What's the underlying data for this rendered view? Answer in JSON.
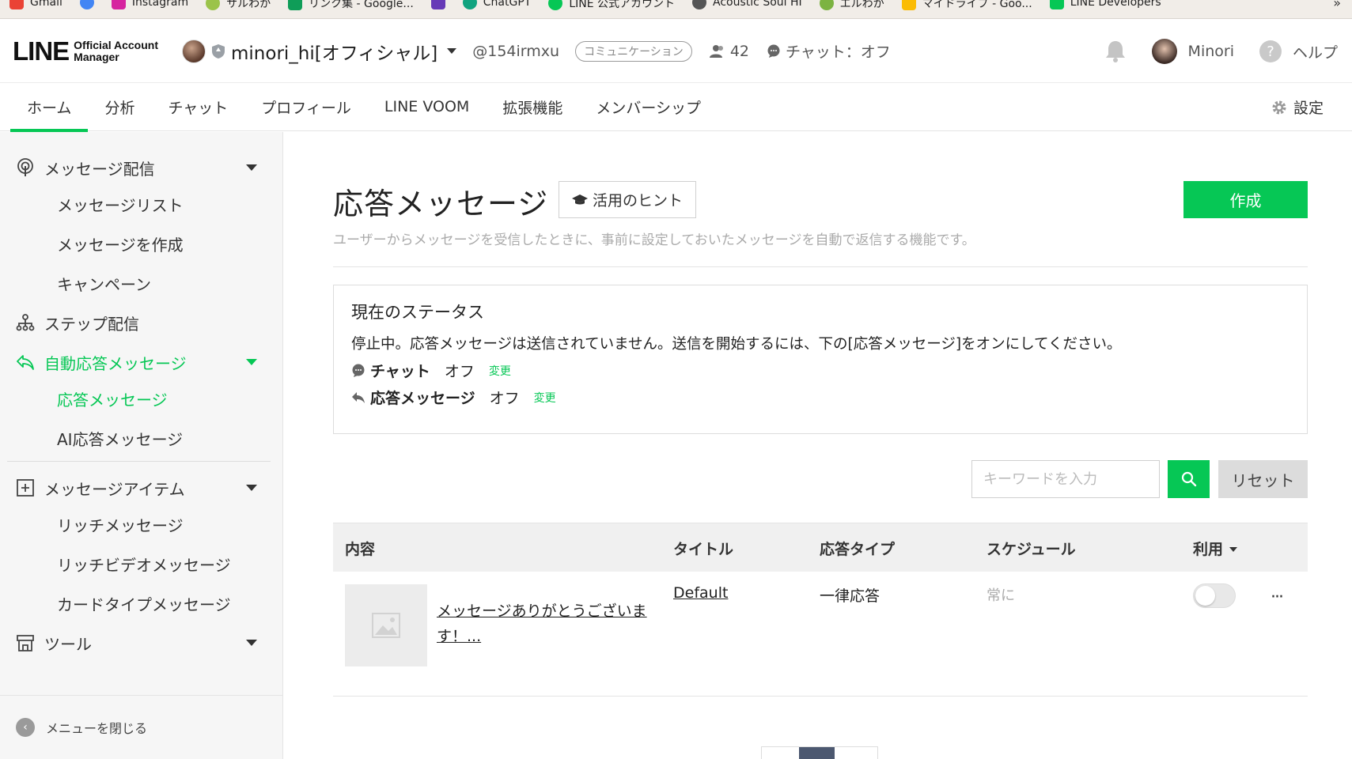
{
  "bookmarks": [
    {
      "label": "Gmail",
      "color": "#ea4335"
    },
    {
      "label": "",
      "color": "#4285f4"
    },
    {
      "label": "Instagram",
      "color": "#d6249f"
    },
    {
      "label": "サルわか",
      "color": "#9bc34a"
    },
    {
      "label": "リンク集 - Google...",
      "color": "#0f9d58"
    },
    {
      "label": "",
      "color": "#673ab7"
    },
    {
      "label": "ChatGPT",
      "color": "#10a37f"
    },
    {
      "label": "LINE 公式アカウント",
      "color": "#06c755"
    },
    {
      "label": "Acoustic Soul HI",
      "color": "#555555"
    },
    {
      "label": "エルわか",
      "color": "#7cb342"
    },
    {
      "label": "マイドライブ - Goo...",
      "color": "#fbbc04"
    },
    {
      "label": "LINE Developers",
      "color": "#06c755"
    }
  ],
  "bookmarks_more": "»",
  "header": {
    "logo_main": "LINE",
    "logo_sub1": "Official Account",
    "logo_sub2": "Manager",
    "account_name": "minori_hi[オフィシャル]",
    "account_id": "@154irmxu",
    "plan_badge": "コミュニケーション",
    "friend_count": "42",
    "chat_status": "チャット：オフ",
    "user_name": "Minori",
    "help_label": "ヘルプ",
    "help_glyph": "?"
  },
  "nav": {
    "tabs": [
      "ホーム",
      "分析",
      "チャット",
      "プロフィール",
      "LINE VOOM",
      "拡張機能",
      "メンバーシップ"
    ],
    "active_index": 0,
    "settings_label": "設定"
  },
  "sidebar": {
    "message_delivery": "メッセージ配信",
    "message_list": "メッセージリスト",
    "create_message": "メッセージを作成",
    "campaign": "キャンペーン",
    "step_delivery": "ステップ配信",
    "auto_reply": "自動応答メッセージ",
    "response_message": "応答メッセージ",
    "ai_response": "AI応答メッセージ",
    "message_items": "メッセージアイテム",
    "rich_message": "リッチメッセージ",
    "rich_video": "リッチビデオメッセージ",
    "card_type": "カードタイプメッセージ",
    "tools": "ツール",
    "close_menu": "メニューを閉じる",
    "close_glyph": "‹"
  },
  "main": {
    "title": "応答メッセージ",
    "hint_label": "活用のヒント",
    "create_label": "作成",
    "description": "ユーザーからメッセージを受信したときに、事前に設定しておいたメッセージを自動で返信する機能です。",
    "status": {
      "title": "現在のステータス",
      "text": "停止中。応答メッセージは送信されていません。送信を開始するには、下の[応答メッセージ]をオンにしてください。",
      "chat_label": "チャット",
      "chat_value": "オフ",
      "response_label": "応答メッセージ",
      "response_value": "オフ",
      "change_label": "変更"
    },
    "search": {
      "placeholder": "キーワードを入力",
      "reset_label": "リセット"
    },
    "table": {
      "headers": [
        "内容",
        "タイトル",
        "応答タイプ",
        "スケジュール",
        "利用"
      ],
      "rows": [
        {
          "content": "メッセージありがとうございます！...",
          "title": "Default",
          "type": "一律応答",
          "schedule": "常に",
          "enabled": false,
          "more": "···"
        }
      ]
    }
  },
  "colors": {
    "brand_green": "#06c755",
    "pager_active": "#4c5870"
  }
}
